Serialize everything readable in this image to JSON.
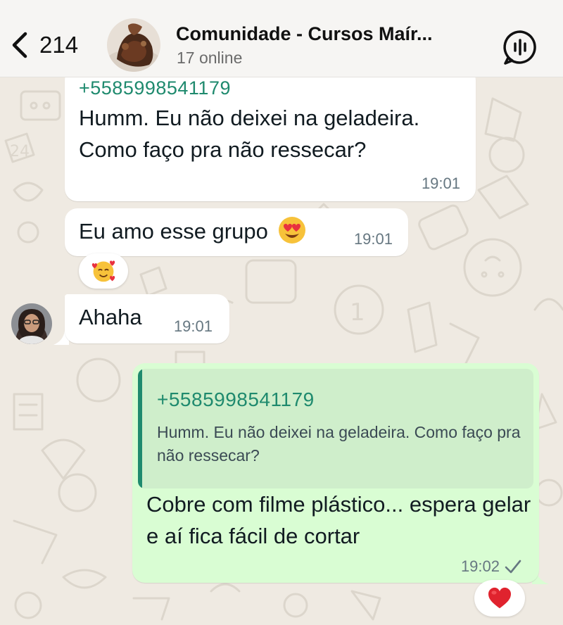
{
  "header": {
    "back_count": "214",
    "title": "Comunidade - Cursos Maír...",
    "subtitle": "17 online"
  },
  "messages": [
    {
      "sender": "+5585998541179",
      "text": "Humm. Eu não deixei na geladeira. Como faço pra não ressecar?",
      "time": "19:01"
    },
    {
      "text": "Eu amo esse grupo",
      "emoji": "heart-eyes-emoji",
      "time": "19:01",
      "reaction": "smiling-face-with-hearts-emoji"
    },
    {
      "text": "Ahaha",
      "time": "19:01"
    },
    {
      "quote_sender": "+5585998541179",
      "quote_text": "Humm. Eu não deixei na geladeira. Como faço pra não ressecar?",
      "text": "Cobre com filme plástico... espera gelar e aí fica fácil de cortar",
      "time": "19:02",
      "status": "sent-check-icon",
      "reaction": "red-heart-emoji"
    }
  ],
  "colors": {
    "wallpaper": "#efeae2",
    "incoming_bubble": "#ffffff",
    "outgoing_bubble": "#d9fdd3",
    "sender_name": "#1f8a6e"
  }
}
